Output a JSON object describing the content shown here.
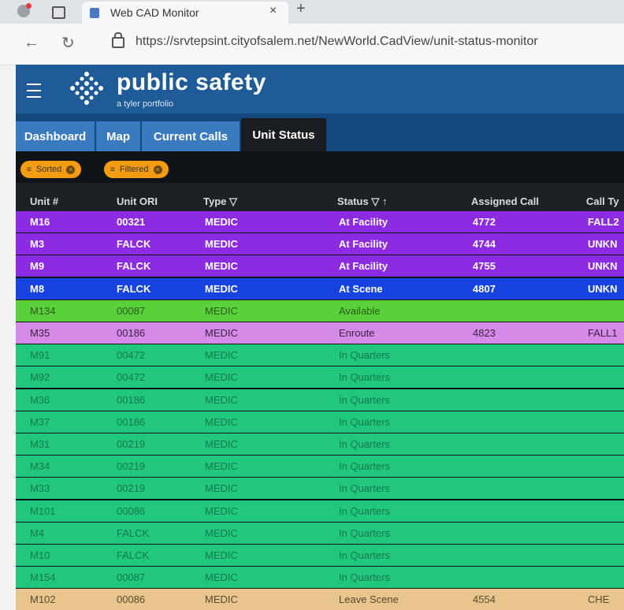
{
  "browser": {
    "tab_title": "Web CAD Monitor",
    "tab_close": "×",
    "new_tab": "+",
    "url": "https://srvtepsint.cityofsalem.net/NewWorld.CadView/unit-status-monitor"
  },
  "app": {
    "brand": "public safety",
    "brand_sub": "a tyler portfolio",
    "colors": {
      "header": "#1f5b96",
      "nav": "#13497d",
      "tab": "#3a7bbf",
      "filter_pill": "#f39c12"
    }
  },
  "nav": {
    "tabs": [
      "Dashboard",
      "Map",
      "Current Calls",
      "Unit Status"
    ],
    "active": "Unit Status"
  },
  "filters": {
    "sorted_label": "Sorted",
    "filtered_label": "Filtered"
  },
  "table": {
    "columns": [
      "Unit #",
      "Unit ORI",
      "Type",
      "Status",
      "Assigned Call",
      "Call Ty"
    ],
    "type_filter_icon": "▽",
    "status_filter_icon": "▽ ↑",
    "status_colors": {
      "At Facility": "#8d2be2",
      "At Scene": "#1744e0",
      "Available": "#58d13a",
      "Enroute": "#d68ae8",
      "In Quarters": "#20c77d",
      "Leave Scene": "#e7c58d"
    },
    "rows": [
      {
        "unit": "M16",
        "ori": "00321",
        "type": "MEDIC",
        "status": "At Facility",
        "call": "4772",
        "calltype": "FALL2"
      },
      {
        "unit": "M3",
        "ori": "FALCK",
        "type": "MEDIC",
        "status": "At Facility",
        "call": "4744",
        "calltype": "UNKN"
      },
      {
        "unit": "M9",
        "ori": "FALCK",
        "type": "MEDIC",
        "status": "At Facility",
        "call": "4755",
        "calltype": "UNKN"
      },
      {
        "unit": "M8",
        "ori": "FALCK",
        "type": "MEDIC",
        "status": "At Scene",
        "call": "4807",
        "calltype": "UNKN"
      },
      {
        "unit": "M134",
        "ori": "00087",
        "type": "MEDIC",
        "status": "Available",
        "call": "",
        "calltype": ""
      },
      {
        "unit": "M35",
        "ori": "00186",
        "type": "MEDIC",
        "status": "Enroute",
        "call": "4823",
        "calltype": "FALL1"
      },
      {
        "unit": "M91",
        "ori": "00472",
        "type": "MEDIC",
        "status": "In Quarters",
        "call": "",
        "calltype": ""
      },
      {
        "unit": "M92",
        "ori": "00472",
        "type": "MEDIC",
        "status": "In Quarters",
        "call": "",
        "calltype": ""
      },
      {
        "unit": "M36",
        "ori": "00186",
        "type": "MEDIC",
        "status": "In Quarters",
        "call": "",
        "calltype": ""
      },
      {
        "unit": "M37",
        "ori": "00186",
        "type": "MEDIC",
        "status": "In Quarters",
        "call": "",
        "calltype": ""
      },
      {
        "unit": "M31",
        "ori": "00219",
        "type": "MEDIC",
        "status": "In Quarters",
        "call": "",
        "calltype": ""
      },
      {
        "unit": "M34",
        "ori": "00219",
        "type": "MEDIC",
        "status": "In Quarters",
        "call": "",
        "calltype": ""
      },
      {
        "unit": "M33",
        "ori": "00219",
        "type": "MEDIC",
        "status": "In Quarters",
        "call": "",
        "calltype": ""
      },
      {
        "unit": "M101",
        "ori": "00086",
        "type": "MEDIC",
        "status": "In Quarters",
        "call": "",
        "calltype": ""
      },
      {
        "unit": "M4",
        "ori": "FALCK",
        "type": "MEDIC",
        "status": "In Quarters",
        "call": "",
        "calltype": ""
      },
      {
        "unit": "M10",
        "ori": "FALCK",
        "type": "MEDIC",
        "status": "In Quarters",
        "call": "",
        "calltype": ""
      },
      {
        "unit": "M154",
        "ori": "00087",
        "type": "MEDIC",
        "status": "In Quarters",
        "call": "",
        "calltype": ""
      },
      {
        "unit": "M102",
        "ori": "00086",
        "type": "MEDIC",
        "status": "Leave Scene",
        "call": "4554",
        "calltype": "CHE"
      }
    ]
  }
}
